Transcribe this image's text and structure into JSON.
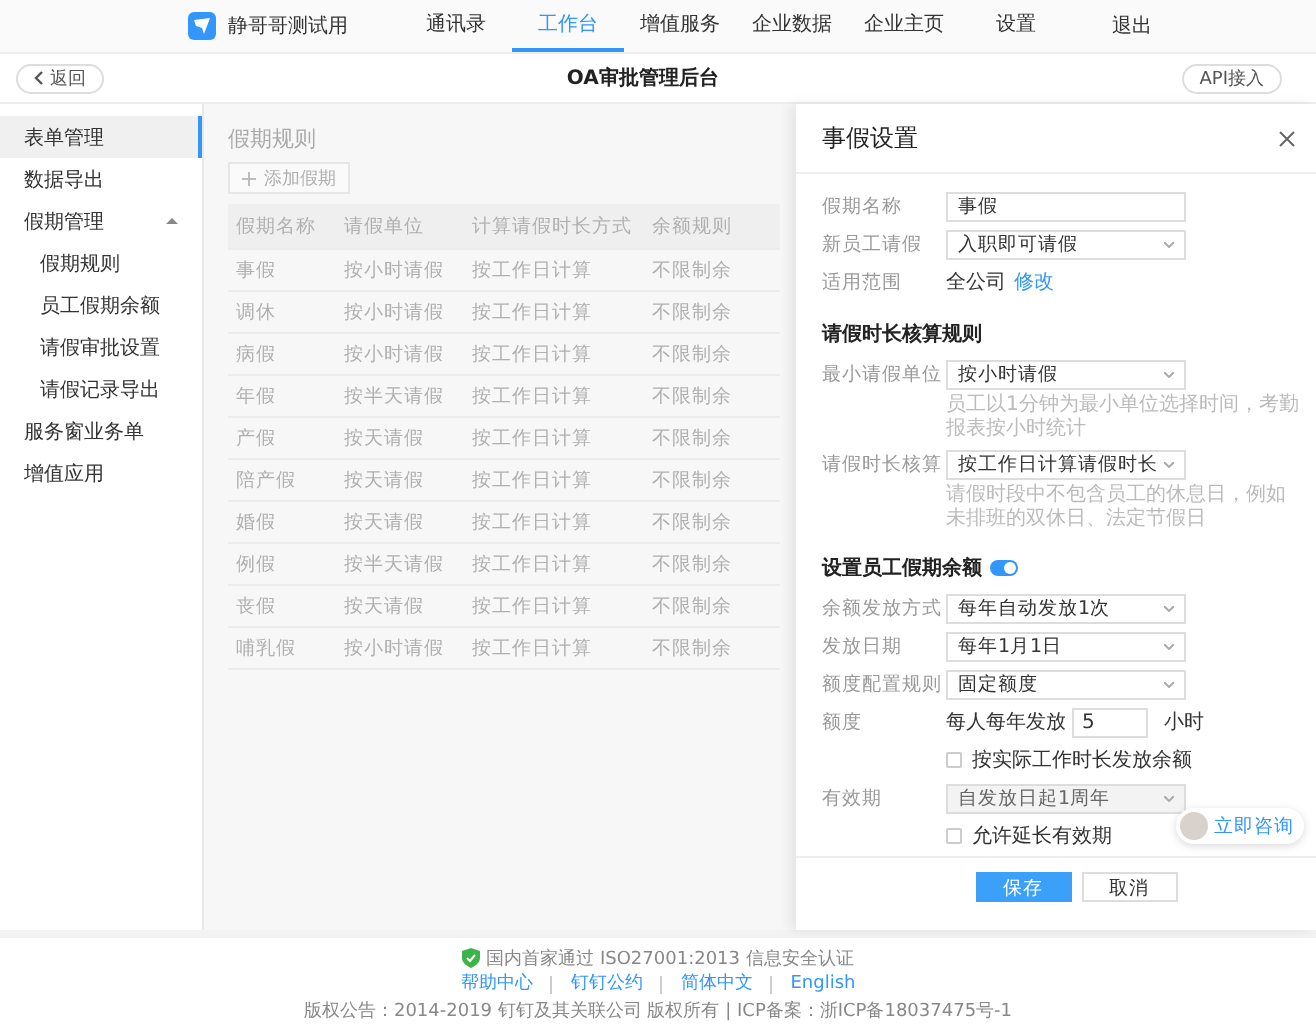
{
  "top_nav": {
    "brand": "静哥哥测试用",
    "items": [
      {
        "label": "通讯录",
        "selected": false
      },
      {
        "label": "工作台",
        "selected": true
      },
      {
        "label": "增值服务",
        "selected": false
      },
      {
        "label": "企业数据",
        "selected": false
      },
      {
        "label": "企业主页",
        "selected": false
      },
      {
        "label": "设置",
        "selected": false
      }
    ],
    "logout": "退出"
  },
  "sub_header": {
    "back": "返回",
    "title": "OA审批管理后台",
    "api_button": "API接入"
  },
  "sidebar": {
    "items": [
      {
        "label": "表单管理",
        "selected": true
      },
      {
        "label": "数据导出",
        "selected": false
      },
      {
        "label": "假期管理",
        "selected": false,
        "expanded": true,
        "children": [
          {
            "label": "假期规则",
            "selected": false
          },
          {
            "label": "员工假期余额",
            "selected": false
          },
          {
            "label": "请假审批设置",
            "selected": false
          },
          {
            "label": "请假记录导出",
            "selected": false
          }
        ]
      },
      {
        "label": "服务窗业务单",
        "selected": false
      },
      {
        "label": "增值应用",
        "selected": false
      }
    ]
  },
  "content": {
    "title": "假期规则",
    "add_button": "添加假期",
    "table": {
      "columns": [
        "假期名称",
        "请假单位",
        "计算请假时长方式",
        "余额规则"
      ],
      "rows": [
        [
          "事假",
          "按小时请假",
          "按工作日计算",
          "不限制余"
        ],
        [
          "调休",
          "按小时请假",
          "按工作日计算",
          "不限制余"
        ],
        [
          "病假",
          "按小时请假",
          "按工作日计算",
          "不限制余"
        ],
        [
          "年假",
          "按半天请假",
          "按工作日计算",
          "不限制余"
        ],
        [
          "产假",
          "按天请假",
          "按工作日计算",
          "不限制余"
        ],
        [
          "陪产假",
          "按天请假",
          "按工作日计算",
          "不限制余"
        ],
        [
          "婚假",
          "按天请假",
          "按工作日计算",
          "不限制余"
        ],
        [
          "例假",
          "按半天请假",
          "按工作日计算",
          "不限制余"
        ],
        [
          "丧假",
          "按天请假",
          "按工作日计算",
          "不限制余"
        ],
        [
          "哺乳假",
          "按小时请假",
          "按工作日计算",
          "不限制余"
        ]
      ]
    }
  },
  "drawer": {
    "title": "事假设置",
    "fields": [
      {
        "kind": "input",
        "label": "假期名称",
        "value": "事假"
      },
      {
        "kind": "select",
        "label": "新员工请假",
        "value": "入职即可请假",
        "disabled": false
      },
      {
        "kind": "text",
        "label": "适用范围",
        "value": "全公司",
        "link": "修改"
      },
      {
        "kind": "section",
        "label": "请假时长核算规则"
      },
      {
        "kind": "select",
        "label": "最小请假单位",
        "value": "按小时请假",
        "disabled": false,
        "hint": "员工以1分钟为最小单位选择时间，考勤报表按小时统计"
      },
      {
        "kind": "select",
        "label": "请假时长核算",
        "value": "按工作日计算请假时长",
        "disabled": false,
        "hint": "请假时段中不包含员工的休息日，例如未排班的双休日、法定节假日"
      },
      {
        "kind": "section",
        "label": "设置员工假期余额",
        "toggle_on": true
      },
      {
        "kind": "select",
        "label": "余额发放方式",
        "value": "每年自动发放1次",
        "disabled": false
      },
      {
        "kind": "select",
        "label": "发放日期",
        "value": "每年1月1日",
        "disabled": false
      },
      {
        "kind": "select",
        "label": "额度配置规则",
        "value": "固定额度",
        "disabled": false
      },
      {
        "kind": "quota",
        "label": "额度",
        "prefix": "每人每年发放",
        "value": "5",
        "unit": "小时"
      },
      {
        "kind": "checkbox",
        "label": "按实际工作时长发放余额",
        "checked": false
      },
      {
        "kind": "select",
        "label": "有效期",
        "value": "自发放日起1周年",
        "disabled": true
      },
      {
        "kind": "checkbox",
        "label": "允许延长有效期",
        "checked": false
      }
    ],
    "buttons": [
      {
        "label": "保存",
        "kind": "primary"
      },
      {
        "label": "取消",
        "kind": "default"
      }
    ]
  },
  "consult": {
    "label": "立即咨询"
  },
  "footer": {
    "certification": "国内首家通过 ISO27001:2013 信息安全认证",
    "links": [
      "帮助中心",
      "钉钉公约",
      "简体中文",
      "English"
    ],
    "copyright": "版权公告：2014-2019 钉钉及其关联公司 版权所有 | ICP备案：浙ICP备18037475号-1"
  }
}
